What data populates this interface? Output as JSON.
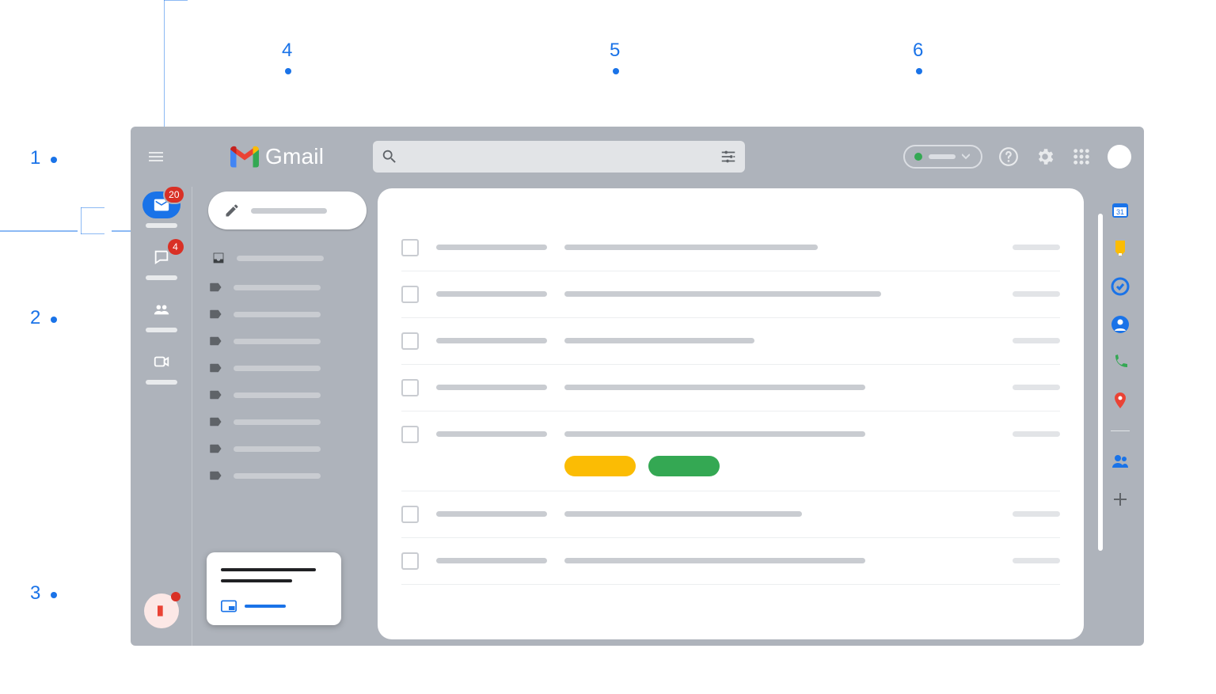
{
  "callouts": {
    "1": "1",
    "2": "2",
    "3": "3",
    "4": "4",
    "5": "5",
    "6": "6"
  },
  "header": {
    "product_name": "Gmail",
    "status": {
      "color": "#34a853"
    }
  },
  "rail": {
    "items": [
      {
        "id": "mail",
        "badge": "20",
        "active": true
      },
      {
        "id": "chat",
        "badge": "4",
        "active": false
      },
      {
        "id": "spaces",
        "badge": "",
        "active": false
      },
      {
        "id": "meet",
        "badge": "",
        "active": false
      }
    ]
  },
  "folders": {
    "items": [
      {
        "id": "inbox",
        "type": "inbox"
      },
      {
        "id": "label-1",
        "type": "label"
      },
      {
        "id": "label-2",
        "type": "label"
      },
      {
        "id": "label-3",
        "type": "label"
      },
      {
        "id": "label-4",
        "type": "label"
      },
      {
        "id": "label-5",
        "type": "label"
      },
      {
        "id": "label-6",
        "type": "label"
      },
      {
        "id": "label-7",
        "type": "label"
      },
      {
        "id": "label-8",
        "type": "label"
      }
    ]
  },
  "inbox": {
    "rows": [
      {
        "subject_w": 320,
        "chips": []
      },
      {
        "subject_w": 400,
        "chips": []
      },
      {
        "subject_w": 240,
        "chips": []
      },
      {
        "subject_w": 380,
        "chips": []
      },
      {
        "subject_w": 380,
        "chips": [
          {
            "w": 90,
            "color": "#fbbc04"
          },
          {
            "w": 90,
            "color": "#34a853"
          }
        ]
      },
      {
        "subject_w": 300,
        "chips": []
      },
      {
        "subject_w": 380,
        "chips": []
      }
    ]
  },
  "side": {
    "items": [
      {
        "id": "calendar",
        "color": "#1a73e8",
        "type": "calendar"
      },
      {
        "id": "keep",
        "color": "#fbbc04",
        "type": "keep"
      },
      {
        "id": "tasks",
        "color": "#1a73e8",
        "type": "tasks"
      },
      {
        "id": "contacts",
        "color": "#1a73e8",
        "type": "contacts"
      },
      {
        "id": "voice",
        "color": "#34a853",
        "type": "voice"
      },
      {
        "id": "maps",
        "color": "#ea4335",
        "type": "maps"
      }
    ],
    "extras": [
      {
        "id": "people",
        "color": "#1a73e8",
        "type": "people"
      },
      {
        "id": "add",
        "color": "#5f6368",
        "type": "plus"
      }
    ]
  }
}
